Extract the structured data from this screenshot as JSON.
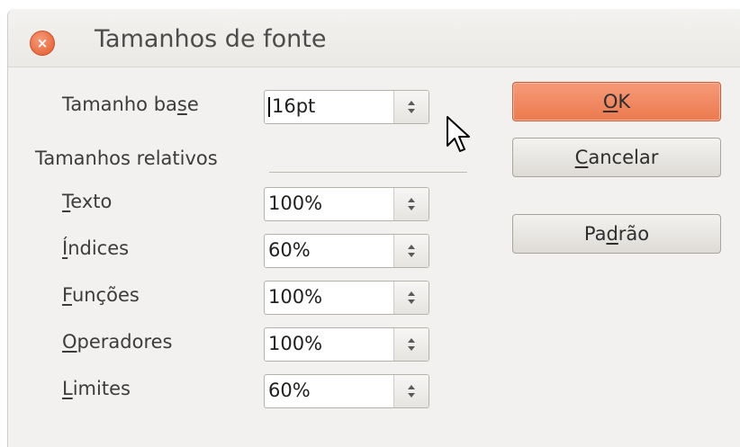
{
  "window": {
    "title": "Tamanhos de fonte",
    "close_glyph": "×"
  },
  "base_size": {
    "label_pre": "Tamanho ba",
    "label_mnemonic": "s",
    "label_post": "e",
    "value": "16pt"
  },
  "relative_section": {
    "title": "Tamanhos relativos",
    "fields": [
      {
        "label_mnemonic": "T",
        "label_rest": "exto",
        "value": "100%"
      },
      {
        "label_mnemonic": "Í",
        "label_rest": "ndices",
        "value": "60%"
      },
      {
        "label_mnemonic": "F",
        "label_rest": "unções",
        "value": "100%"
      },
      {
        "label_mnemonic": "O",
        "label_rest": "peradores",
        "value": "100%"
      },
      {
        "label_mnemonic": "L",
        "label_rest": "imites",
        "value": "60%"
      }
    ]
  },
  "buttons": {
    "ok": {
      "mnemonic": "O",
      "rest": "K"
    },
    "cancel": {
      "mnemonic": "C",
      "rest": "ancelar"
    },
    "default": {
      "pre": "Pa",
      "mnemonic": "d",
      "rest": "rão"
    }
  },
  "colors": {
    "accent": "#ec7a4f",
    "dialog_bg": "#f2f1f0"
  },
  "icons": {
    "close": "close-icon",
    "spin": "spin-arrows-icon",
    "pointer": "mouse-pointer-icon"
  }
}
